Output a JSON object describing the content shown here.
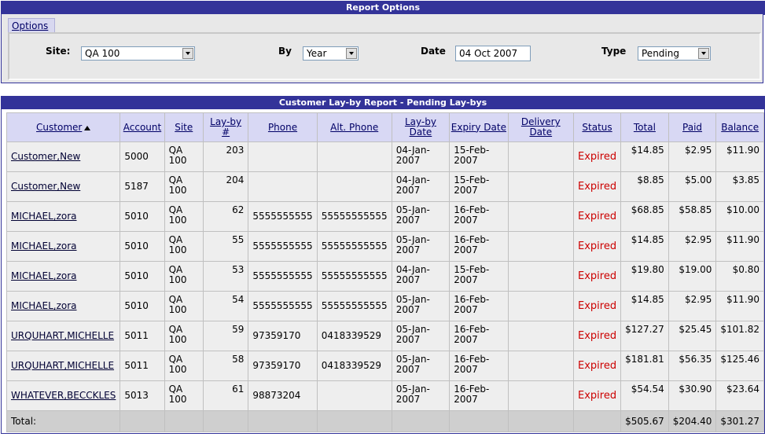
{
  "options": {
    "header": "Report Options",
    "tab_label": "Options",
    "site_label": "Site:",
    "site_value": "QA 100",
    "by_label": "By",
    "by_value": "Year",
    "date_label": "Date",
    "date_value": "04 Oct 2007",
    "type_label": "Type",
    "type_value": "Pending"
  },
  "report": {
    "header": "Customer Lay-by Report - Pending Lay-bys",
    "columns": {
      "customer": "Customer",
      "account": "Account",
      "site": "Site",
      "layby_no_1": "Lay-by",
      "layby_no_2": "#",
      "phone": "Phone",
      "alt_phone": "Alt. Phone",
      "layby_date_1": "Lay-by",
      "layby_date_2": "Date",
      "expiry_date": "Expiry Date",
      "delivery_date_1": "Delivery",
      "delivery_date_2": "Date",
      "status": "Status",
      "total": "Total",
      "paid": "Paid",
      "balance": "Balance"
    },
    "rows": [
      {
        "customer": "Customer,New",
        "account": "5000",
        "site1": "QA",
        "site2": "100",
        "layby": "203",
        "phone": "",
        "alt_phone": "",
        "ldate1": "04-Jan-",
        "ldate2": "2007",
        "edate1": "15-Feb-",
        "edate2": "2007",
        "delivery": "",
        "status": "Expired",
        "total": "$14.85",
        "paid": "$2.95",
        "balance": "$11.90"
      },
      {
        "customer": "Customer,New",
        "account": "5187",
        "site1": "QA",
        "site2": "100",
        "layby": "204",
        "phone": "",
        "alt_phone": "",
        "ldate1": "04-Jan-",
        "ldate2": "2007",
        "edate1": "15-Feb-",
        "edate2": "2007",
        "delivery": "",
        "status": "Expired",
        "total": "$8.85",
        "paid": "$5.00",
        "balance": "$3.85"
      },
      {
        "customer": "MICHAEL,zora",
        "account": "5010",
        "site1": "QA",
        "site2": "100",
        "layby": "62",
        "phone": "5555555555",
        "alt_phone": "55555555555",
        "ldate1": "05-Jan-",
        "ldate2": "2007",
        "edate1": "16-Feb-",
        "edate2": "2007",
        "delivery": "",
        "status": "Expired",
        "total": "$68.85",
        "paid": "$58.85",
        "balance": "$10.00"
      },
      {
        "customer": "MICHAEL,zora",
        "account": "5010",
        "site1": "QA",
        "site2": "100",
        "layby": "55",
        "phone": "5555555555",
        "alt_phone": "55555555555",
        "ldate1": "05-Jan-",
        "ldate2": "2007",
        "edate1": "16-Feb-",
        "edate2": "2007",
        "delivery": "",
        "status": "Expired",
        "total": "$14.85",
        "paid": "$2.95",
        "balance": "$11.90"
      },
      {
        "customer": "MICHAEL,zora",
        "account": "5010",
        "site1": "QA",
        "site2": "100",
        "layby": "53",
        "phone": "5555555555",
        "alt_phone": "55555555555",
        "ldate1": "04-Jan-",
        "ldate2": "2007",
        "edate1": "15-Feb-",
        "edate2": "2007",
        "delivery": "",
        "status": "Expired",
        "total": "$19.80",
        "paid": "$19.00",
        "balance": "$0.80"
      },
      {
        "customer": "MICHAEL,zora",
        "account": "5010",
        "site1": "QA",
        "site2": "100",
        "layby": "54",
        "phone": "5555555555",
        "alt_phone": "55555555555",
        "ldate1": "05-Jan-",
        "ldate2": "2007",
        "edate1": "16-Feb-",
        "edate2": "2007",
        "delivery": "",
        "status": "Expired",
        "total": "$14.85",
        "paid": "$2.95",
        "balance": "$11.90"
      },
      {
        "customer": "URQUHART,MICHELLE",
        "account": "5011",
        "site1": "QA",
        "site2": "100",
        "layby": "59",
        "phone": "97359170",
        "alt_phone": "0418339529",
        "ldate1": "05-Jan-",
        "ldate2": "2007",
        "edate1": "16-Feb-",
        "edate2": "2007",
        "delivery": "",
        "status": "Expired",
        "total": "$127.27",
        "paid": "$25.45",
        "balance": "$101.82"
      },
      {
        "customer": "URQUHART,MICHELLE",
        "account": "5011",
        "site1": "QA",
        "site2": "100",
        "layby": "58",
        "phone": "97359170",
        "alt_phone": "0418339529",
        "ldate1": "05-Jan-",
        "ldate2": "2007",
        "edate1": "16-Feb-",
        "edate2": "2007",
        "delivery": "",
        "status": "Expired",
        "total": "$181.81",
        "paid": "$56.35",
        "balance": "$125.46"
      },
      {
        "customer": "WHATEVER,BECCKLES",
        "account": "5013",
        "site1": "QA",
        "site2": "100",
        "layby": "61",
        "phone": "98873204",
        "alt_phone": "",
        "ldate1": "05-Jan-",
        "ldate2": "2007",
        "edate1": "16-Feb-",
        "edate2": "2007",
        "delivery": "",
        "status": "Expired",
        "total": "$54.54",
        "paid": "$30.90",
        "balance": "$23.64"
      }
    ],
    "totals": {
      "label": "Total:",
      "total": "$505.67",
      "paid": "$204.40",
      "balance": "$301.27"
    }
  }
}
